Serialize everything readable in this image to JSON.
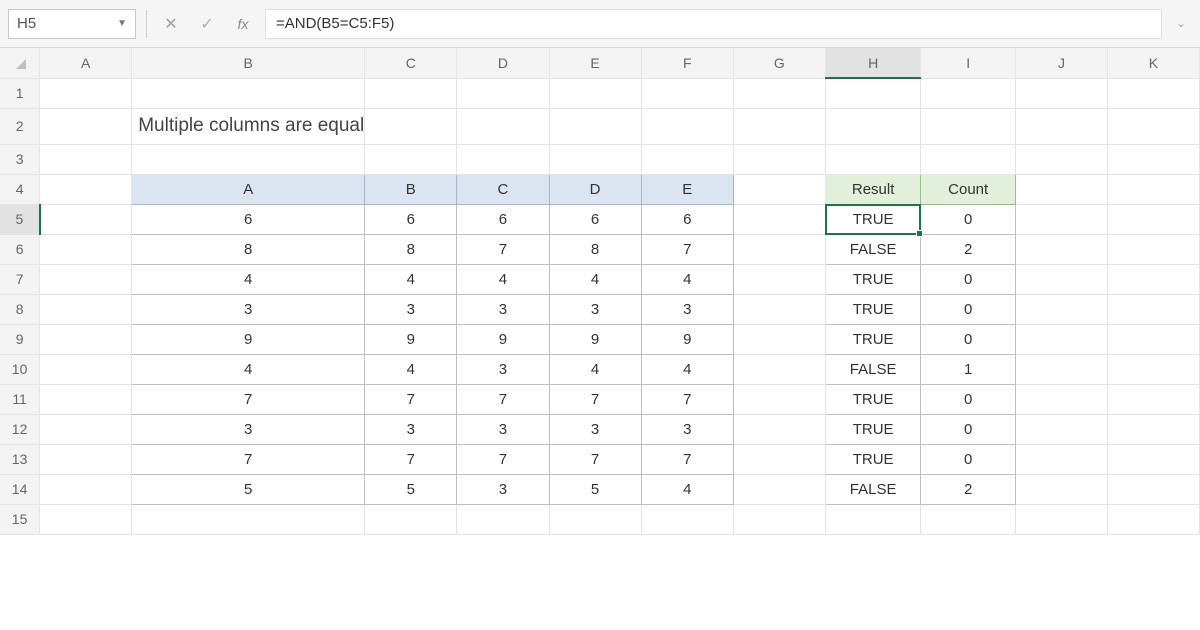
{
  "formula_bar": {
    "cell_ref": "H5",
    "fx_label": "fx",
    "formula": "=AND(B5=C5:F5)"
  },
  "columns": [
    "A",
    "B",
    "C",
    "D",
    "E",
    "F",
    "G",
    "H",
    "I",
    "J",
    "K"
  ],
  "rows": [
    "1",
    "2",
    "3",
    "4",
    "5",
    "6",
    "7",
    "8",
    "9",
    "10",
    "11",
    "12",
    "13",
    "14",
    "15"
  ],
  "active": {
    "col": "H",
    "row": "5"
  },
  "title": "Multiple columns are equal",
  "data_table": {
    "headers": [
      "A",
      "B",
      "C",
      "D",
      "E"
    ],
    "rows": [
      [
        "6",
        "6",
        "6",
        "6",
        "6"
      ],
      [
        "8",
        "8",
        "7",
        "8",
        "7"
      ],
      [
        "4",
        "4",
        "4",
        "4",
        "4"
      ],
      [
        "3",
        "3",
        "3",
        "3",
        "3"
      ],
      [
        "9",
        "9",
        "9",
        "9",
        "9"
      ],
      [
        "4",
        "4",
        "3",
        "4",
        "4"
      ],
      [
        "7",
        "7",
        "7",
        "7",
        "7"
      ],
      [
        "3",
        "3",
        "3",
        "3",
        "3"
      ],
      [
        "7",
        "7",
        "7",
        "7",
        "7"
      ],
      [
        "5",
        "5",
        "3",
        "5",
        "4"
      ]
    ]
  },
  "result_table": {
    "headers": [
      "Result",
      "Count"
    ],
    "rows": [
      [
        "TRUE",
        "0"
      ],
      [
        "FALSE",
        "2"
      ],
      [
        "TRUE",
        "0"
      ],
      [
        "TRUE",
        "0"
      ],
      [
        "TRUE",
        "0"
      ],
      [
        "FALSE",
        "1"
      ],
      [
        "TRUE",
        "0"
      ],
      [
        "TRUE",
        "0"
      ],
      [
        "TRUE",
        "0"
      ],
      [
        "FALSE",
        "2"
      ]
    ]
  }
}
